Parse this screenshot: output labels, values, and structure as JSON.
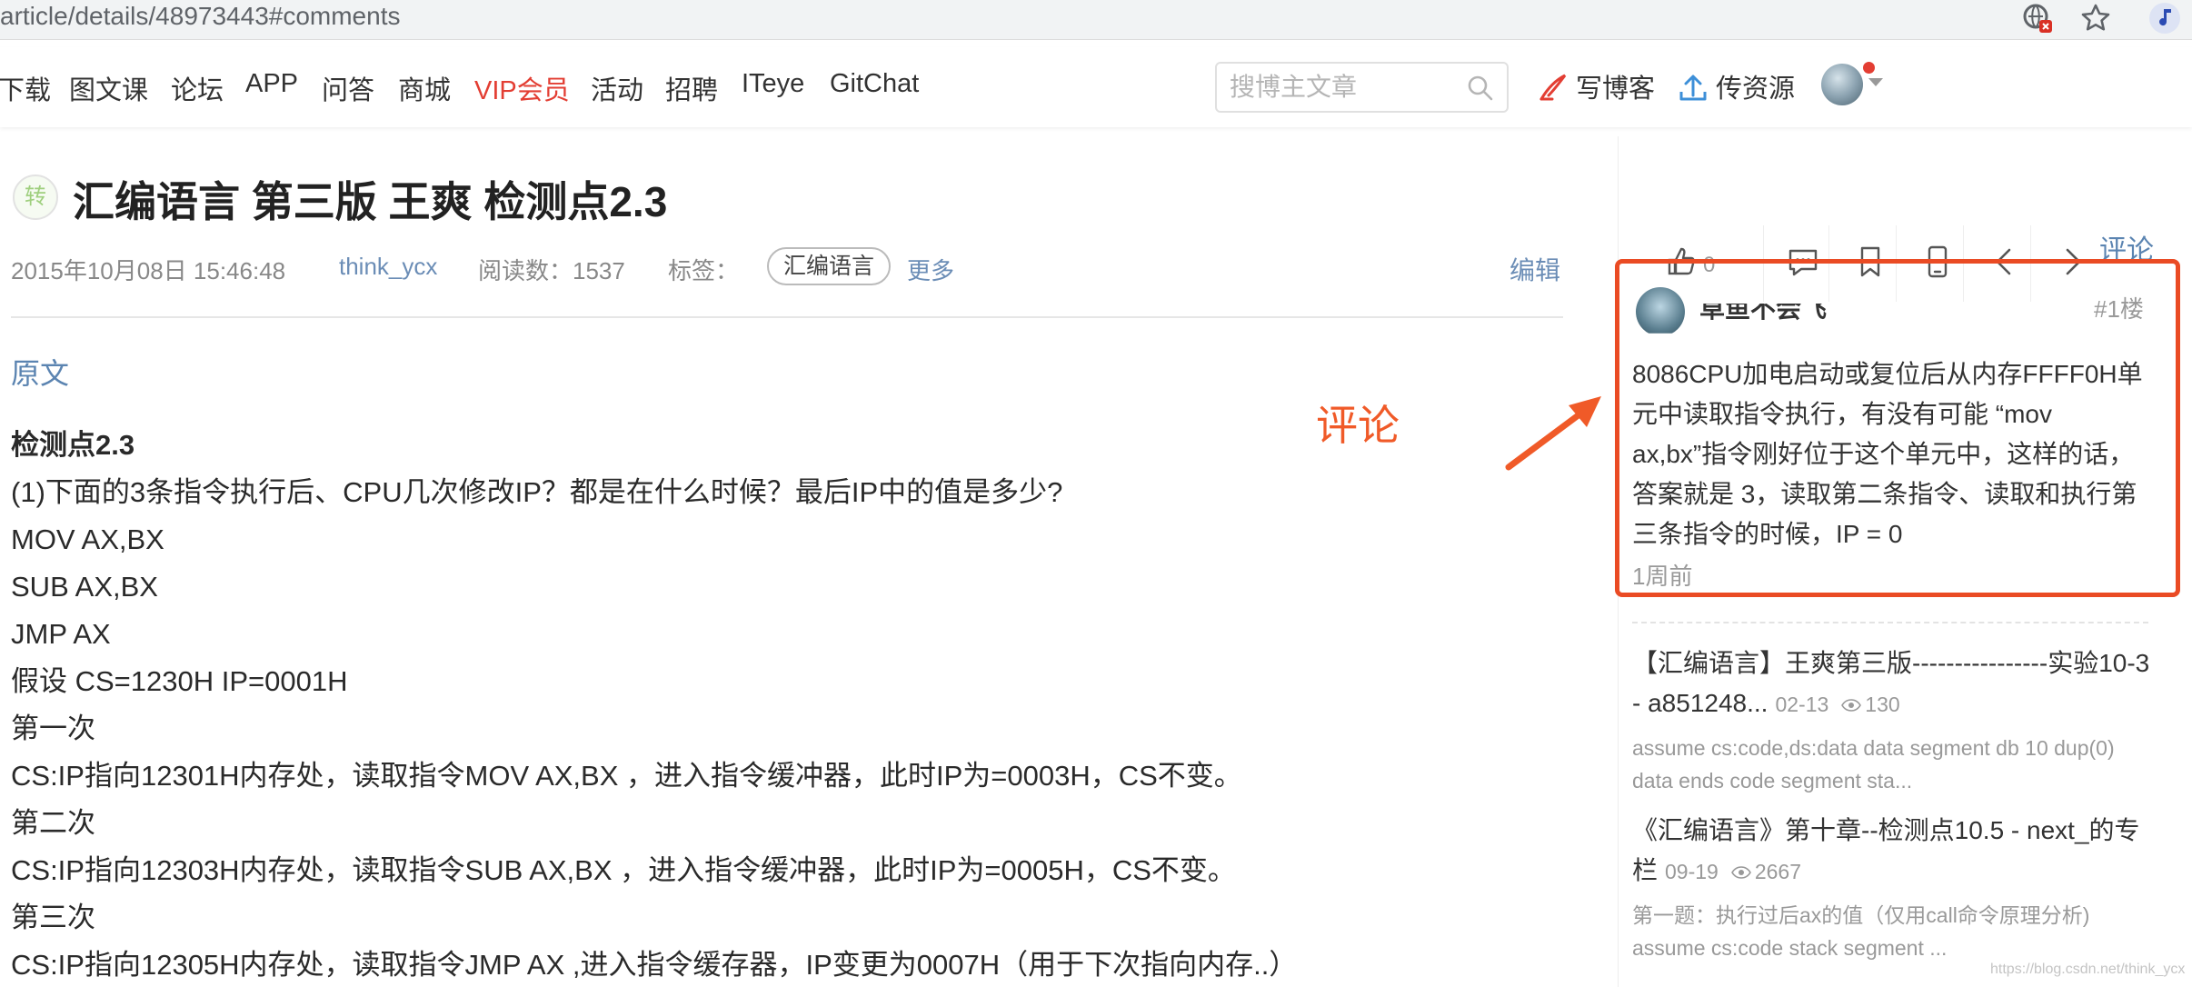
{
  "browser": {
    "url": "article/details/48973443#comments"
  },
  "nav": {
    "items": [
      "下载",
      "图文课",
      "论坛",
      "APP",
      "问答",
      "商城",
      "VIP会员",
      "活动",
      "招聘",
      "ITeye",
      "GitChat"
    ],
    "search_placeholder": "搜博主文章",
    "write_blog": "写博客",
    "upload": "传资源"
  },
  "article": {
    "badge": "转",
    "title": "汇编语言 第三版 王爽 检测点2.3",
    "date": "2015年10月08日 15:46:48",
    "author": "think_ycx",
    "reads": "阅读数：1537",
    "tags_label": "标签：",
    "tag": "汇编语言",
    "more": "更多",
    "edit": "编辑",
    "original": "原文",
    "heading": "检测点2.3",
    "lines": [
      "(1)下面的3条指令执行后、CPU几次修改IP？都是在什么时候？最后IP中的值是多少?",
      "MOV AX,BX",
      "SUB AX,BX",
      "JMP AX",
      "假设 CS=1230H IP=0001H",
      "第一次",
      "CS:IP指向12301H内存处，读取指令MOV AX,BX ，进入指令缓冲器，此时IP为=0003H，CS不变。",
      "第二次",
      "CS:IP指向12303H内存处，读取指令SUB AX,BX ，进入指令缓冲器，此时IP为=0005H，CS不变。",
      "第三次",
      "CS:IP指向12305H内存处，读取指令JMP AX ,进入指令缓存器，IP变更为0007H（用于下次指向内存..）"
    ]
  },
  "annotation": {
    "label": "评论",
    "color": "#f05a28"
  },
  "sidebar": {
    "comment_link": "评论",
    "like_count": "0",
    "comment": {
      "user": "草鱼不会飞",
      "floor": "#1楼",
      "text": "8086CPU加电启动或复位后从内存FFFF0H单元中读取指令执行，有没有可能 “mov ax,bx”指令刚好位于这个单元中，这样的话，答案就是 3，读取第二条指令、读取和执行第三条指令的时候，IP = 0",
      "time": "1周前"
    },
    "recommendations": [
      {
        "title": "【汇编语言】王爽第三版----------------实验10-3 - a851248...",
        "date": "02-13",
        "views": "130",
        "desc": "assume cs:code,ds:data data segment db 10 dup(0) data ends code segment sta..."
      },
      {
        "title": "《汇编语言》第十章--检测点10.5 - next_的专栏",
        "date": "09-19",
        "views": "2667",
        "desc": "第一题：执行过后ax的值（仅用call命令原理分析) assume cs:code stack segment ..."
      }
    ],
    "watermark": "https://blog.csdn.net/think_ycx"
  },
  "colors": {
    "accent_blue": "#5b84b1",
    "vip_red": "#e33e33",
    "highlight_box": "#ea4b24"
  }
}
